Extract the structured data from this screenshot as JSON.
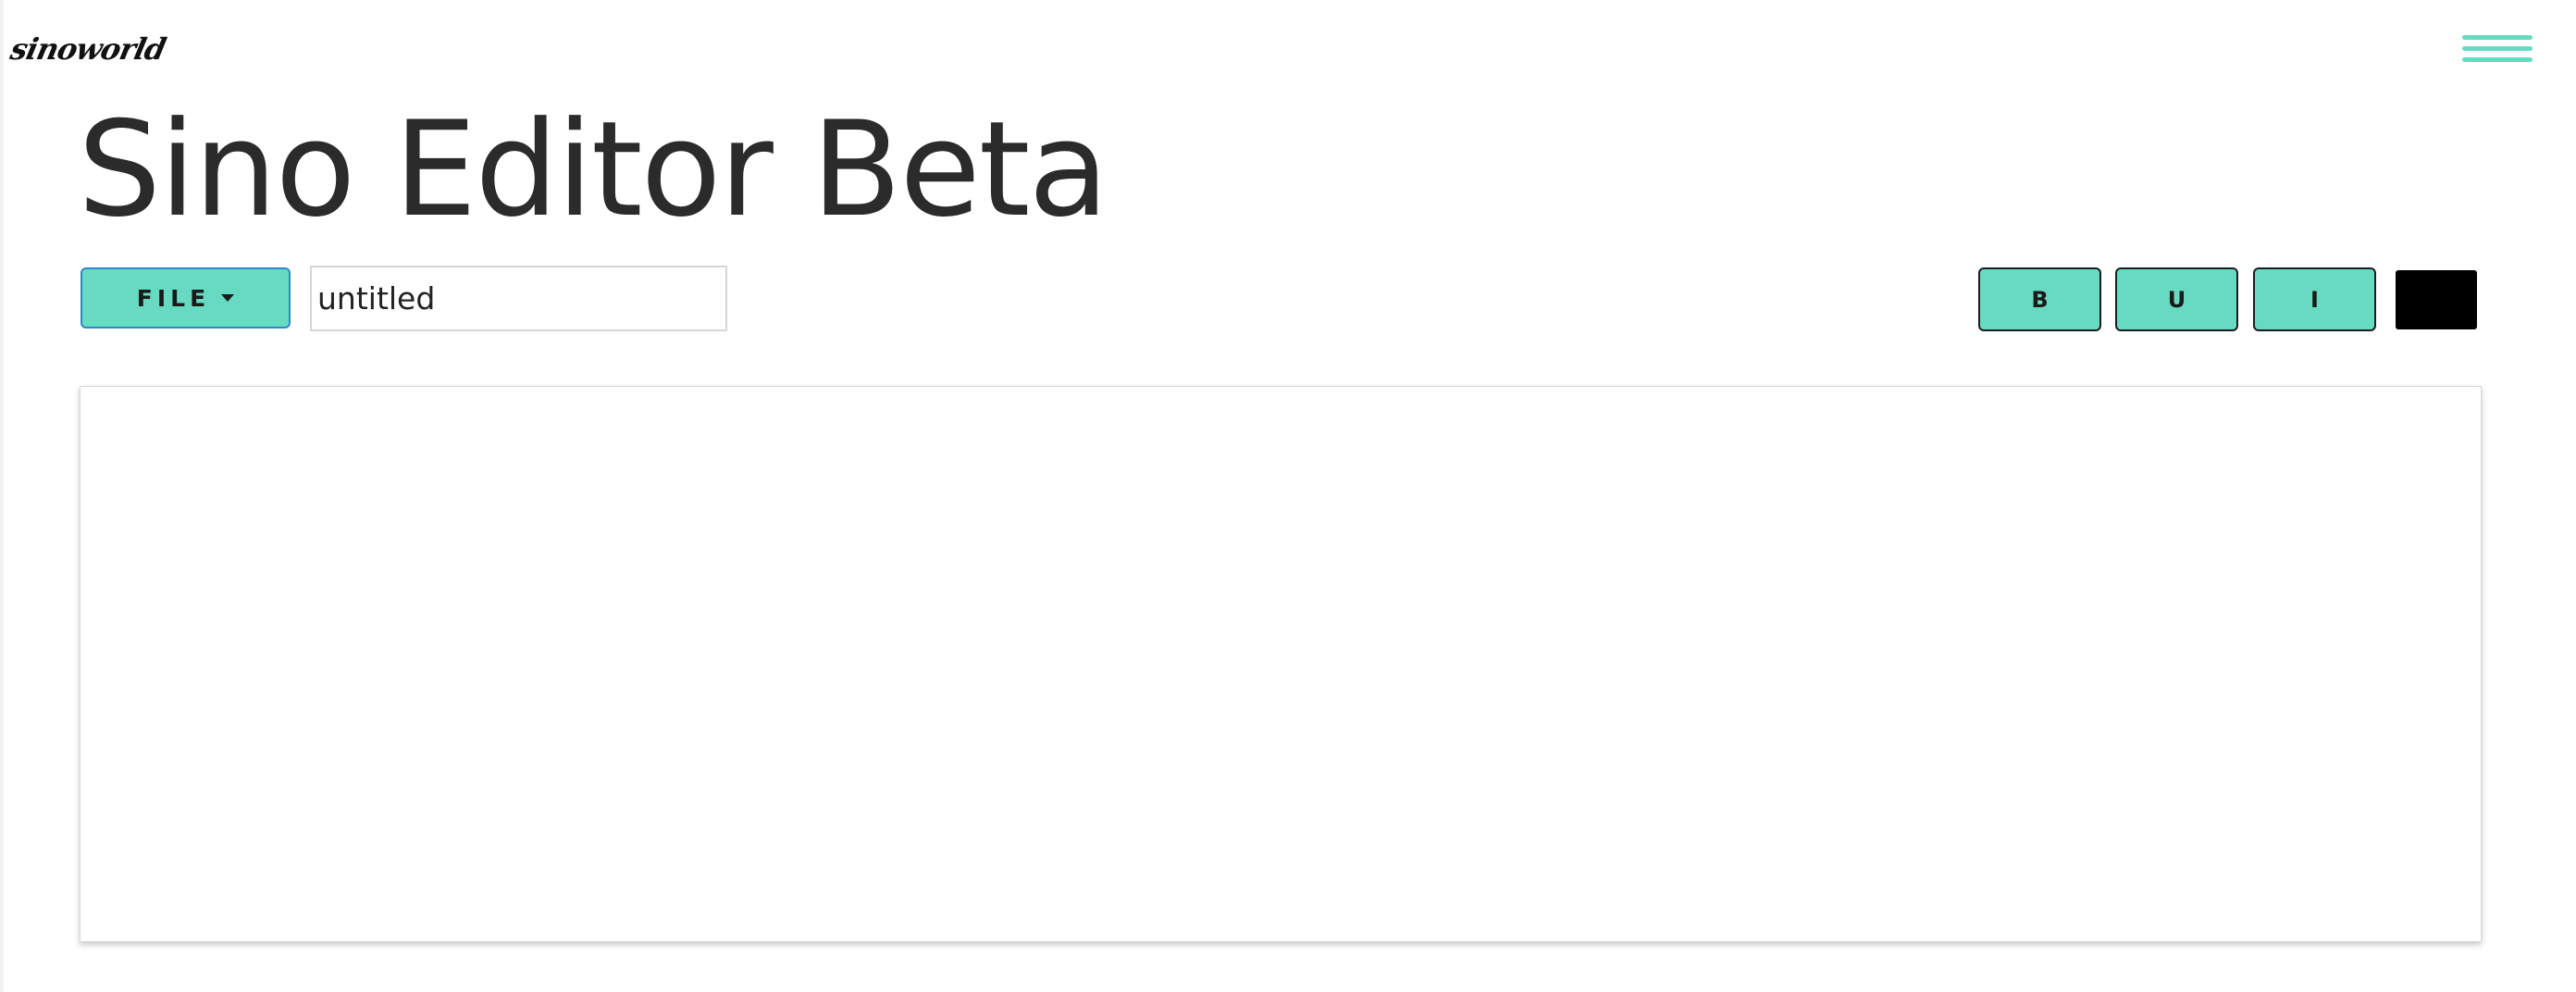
{
  "header": {
    "logo_text": "sinoworld",
    "menu_icon": "hamburger-menu-icon"
  },
  "page": {
    "title": "Sino Editor Beta"
  },
  "toolbar": {
    "file_label": "FILE",
    "file_caret_icon": "caret-down-icon",
    "filename_value": "untitled",
    "bold_label": "B",
    "underline_label": "U",
    "italic_label": "I"
  },
  "editor": {
    "content": ""
  },
  "colors": {
    "accent": "#66dbc1",
    "text_color_swatch": "#000000",
    "title_text": "#2b2b2b"
  }
}
